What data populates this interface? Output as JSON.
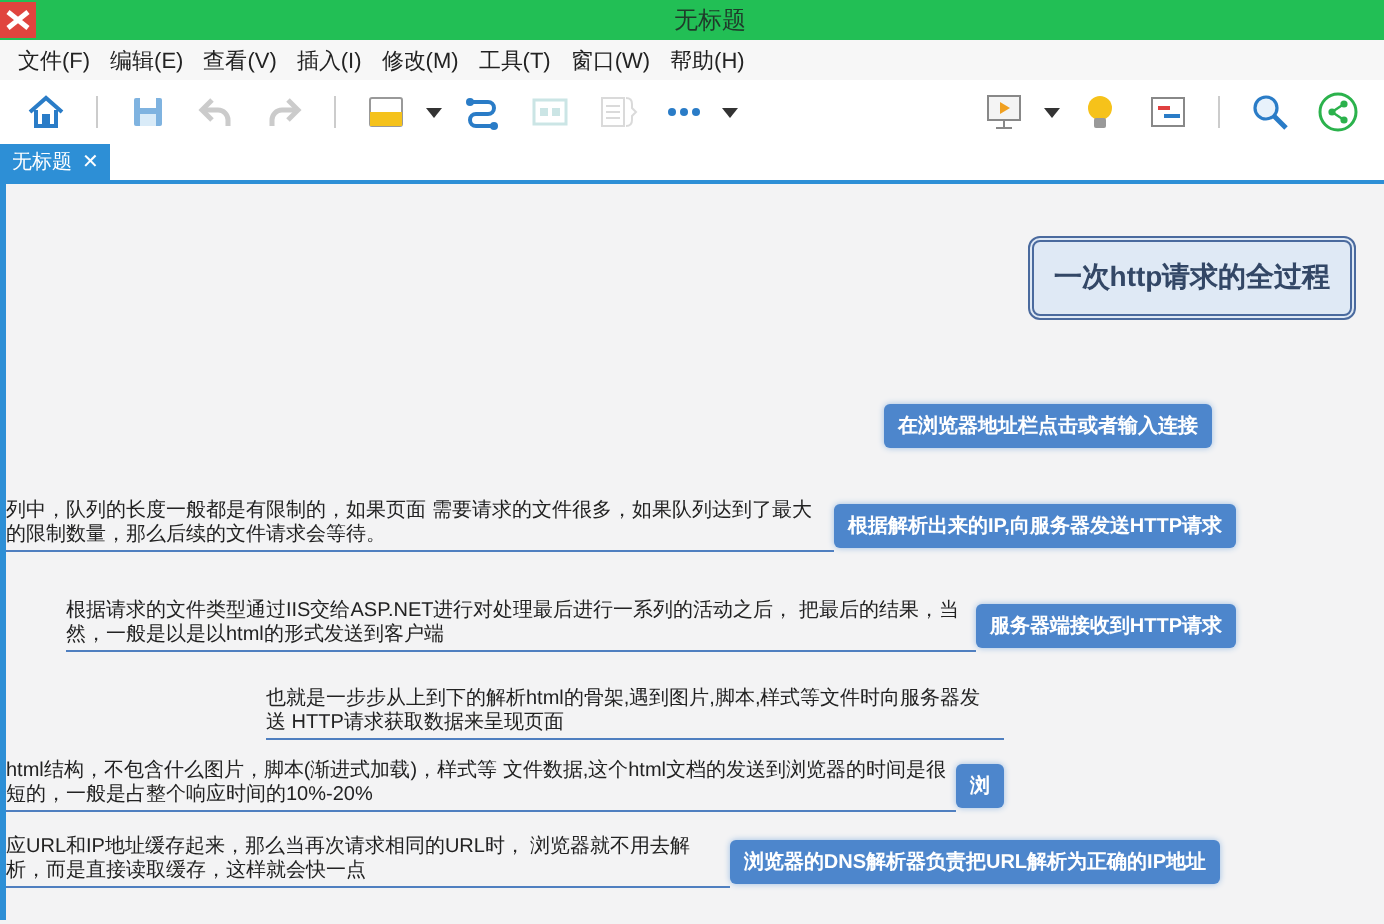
{
  "window": {
    "title": "无标题"
  },
  "menu": [
    "文件(F)",
    "编辑(E)",
    "查看(V)",
    "插入(I)",
    "修改(M)",
    "工具(T)",
    "窗口(W)",
    "帮助(H)"
  ],
  "toolbar": [
    {
      "disabled": false
    },
    {
      "disabled": false
    },
    {
      "disabled": true
    },
    {
      "disabled": true
    },
    {
      "disabled": false
    },
    {
      "disabled": false
    },
    {
      "disabled": true
    },
    {
      "disabled": true
    },
    {
      "disabled": false
    },
    {
      "disabled": false
    },
    {
      "disabled": false
    },
    {
      "disabled": false
    },
    {
      "disabled": false
    },
    {
      "disabled": false
    }
  ],
  "tabs": [
    {
      "label": "无标题",
      "close": "✕",
      "selected": true
    }
  ],
  "map": {
    "root": "一次http请求的全过程",
    "topics": [
      {
        "label": "在浏览器地址栏点击或者输入连接"
      },
      {
        "label": "根据解析出来的IP,向服务器发送HTTP请求",
        "note": "列中，队列的长度一般都是有限制的，如果页面 需要请求的文件很多，如果队列达到了最大的限制数量，那么后续的文件请求会等待。"
      },
      {
        "label": "服务器端接收到HTTP请求",
        "note": "根据请求的文件类型通过IIS交给ASP.NET进行对处理最后进行一系列的活动之后， 把最后的结果，当然，一般是以是以html的形式发送到客户端"
      },
      {
        "note": "也就是一步步从上到下的解析html的骨架,遇到图片,脚本,样式等文件时向服务器发送 HTTP请求获取数据来呈现页面"
      },
      {
        "label": "浏",
        "note": "html结构，不包含什么图片，脚本(渐进式加载)，样式等 文件数据,这个html文档的发送到浏览器的时间是很短的，一般是占整个响应时间的10%-20%"
      },
      {
        "label": "浏览器的DNS解析器负责把URL解析为正确的IP地址",
        "note": "应URL和IP地址缓存起来，那么当再次请求相同的URL时， 浏览器就不用去解析，而是直接读取缓存，这样就会快一点"
      }
    ]
  }
}
